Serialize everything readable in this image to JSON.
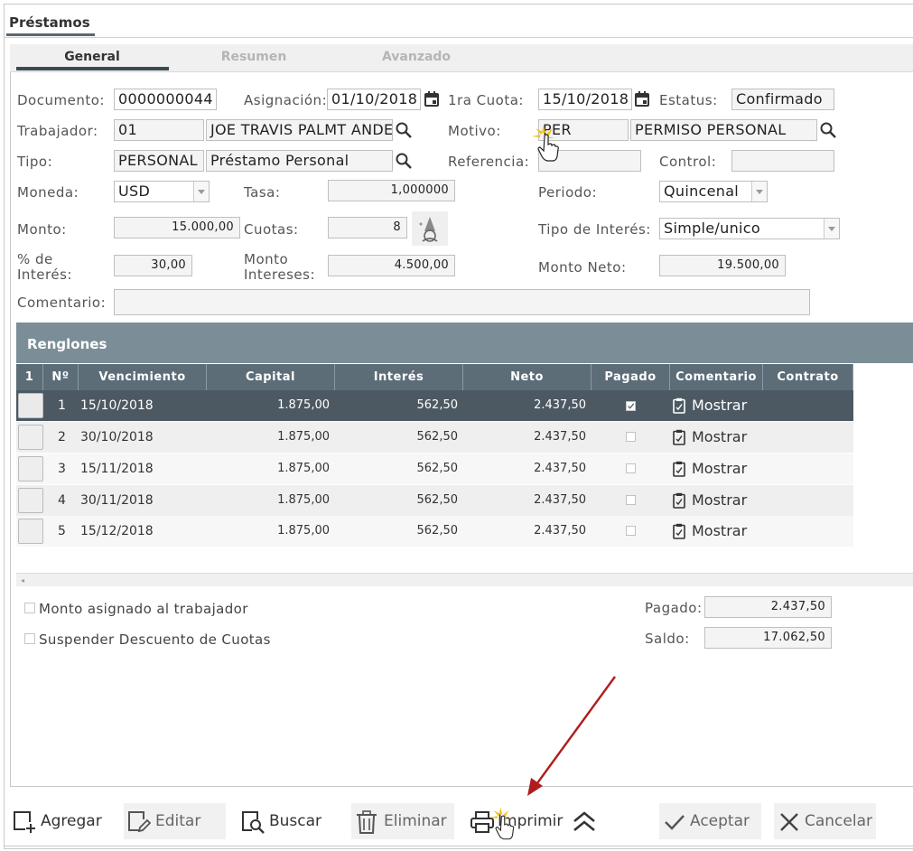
{
  "window": {
    "title": "Préstamos"
  },
  "tabs": [
    {
      "label": "General",
      "active": true
    },
    {
      "label": "Resumen",
      "active": false
    },
    {
      "label": "Avanzado",
      "active": false
    }
  ],
  "form": {
    "documento": {
      "label": "Documento:",
      "value": "0000000044"
    },
    "asignacion": {
      "label": "Asignación:",
      "value": "01/10/2018"
    },
    "primera_cuota": {
      "label": "1ra Cuota:",
      "value": "15/10/2018"
    },
    "estatus": {
      "label": "Estatus:",
      "value": "Confirmado"
    },
    "trabajador": {
      "label": "Trabajador:",
      "code": "01",
      "name": "JOE TRAVIS PALMT ANDERSON"
    },
    "motivo": {
      "label": "Motivo:",
      "code": "PER",
      "name": "PERMISO PERSONAL"
    },
    "tipo": {
      "label": "Tipo:",
      "code": "PERSONAL",
      "name": "Préstamo Personal"
    },
    "referencia": {
      "label": "Referencia:",
      "value": ""
    },
    "control": {
      "label": "Control:",
      "value": ""
    },
    "moneda": {
      "label": "Moneda:",
      "value": "USD"
    },
    "tasa": {
      "label": "Tasa:",
      "value": "1,000000"
    },
    "periodo": {
      "label": "Periodo:",
      "value": "Quincenal"
    },
    "monto": {
      "label": "Monto:",
      "value": "15.000,00"
    },
    "cuotas": {
      "label": "Cuotas:",
      "value": "8"
    },
    "tipo_interes": {
      "label": "Tipo de Interés:",
      "value": "Simple/unico"
    },
    "pct_interes": {
      "label_line1": "% de",
      "label_line2": "Interés:",
      "value": "30,00"
    },
    "monto_intereses": {
      "label_line1": "Monto",
      "label_line2": "Intereses:",
      "value": "4.500,00"
    },
    "monto_neto": {
      "label": "Monto Neto:",
      "value": "19.500,00"
    },
    "comentario": {
      "label": "Comentario:",
      "value": ""
    }
  },
  "renglones": {
    "title": "Renglones",
    "columns": [
      "1",
      "Nº",
      "Vencimiento",
      "Capital",
      "Interés",
      "Neto",
      "Pagado",
      "Comentario",
      "Contrato"
    ],
    "rows": [
      {
        "n": "1",
        "vencimiento": "15/10/2018",
        "capital": "1.875,00",
        "interes": "562,50",
        "neto": "2.437,50",
        "pagado": true,
        "comentario": "Mostrar"
      },
      {
        "n": "2",
        "vencimiento": "30/10/2018",
        "capital": "1.875,00",
        "interes": "562,50",
        "neto": "2.437,50",
        "pagado": false,
        "comentario": "Mostrar"
      },
      {
        "n": "3",
        "vencimiento": "15/11/2018",
        "capital": "1.875,00",
        "interes": "562,50",
        "neto": "2.437,50",
        "pagado": false,
        "comentario": "Mostrar"
      },
      {
        "n": "4",
        "vencimiento": "30/11/2018",
        "capital": "1.875,00",
        "interes": "562,50",
        "neto": "2.437,50",
        "pagado": false,
        "comentario": "Mostrar"
      },
      {
        "n": "5",
        "vencimiento": "15/12/2018",
        "capital": "1.875,00",
        "interes": "562,50",
        "neto": "2.437,50",
        "pagado": false,
        "comentario": "Mostrar"
      }
    ]
  },
  "footer": {
    "monto_asignado": {
      "label": "Monto asignado al trabajador",
      "checked": false
    },
    "suspender": {
      "label": "Suspender Descuento de Cuotas",
      "checked": false
    },
    "pagado": {
      "label": "Pagado:",
      "value": "2.437,50"
    },
    "saldo": {
      "label": "Saldo:",
      "value": "17.062,50"
    }
  },
  "toolbar": {
    "agregar": "Agregar",
    "editar": "Editar",
    "buscar": "Buscar",
    "eliminar": "Eliminar",
    "imprimir": "Imprimir",
    "aceptar": "Aceptar",
    "cancelar": "Cancelar"
  },
  "colors": {
    "header_dark": "#5c6d78",
    "section": "#7b8e98",
    "selected_row": "#4c5963",
    "annotation_arrow": "#b01c1c"
  }
}
